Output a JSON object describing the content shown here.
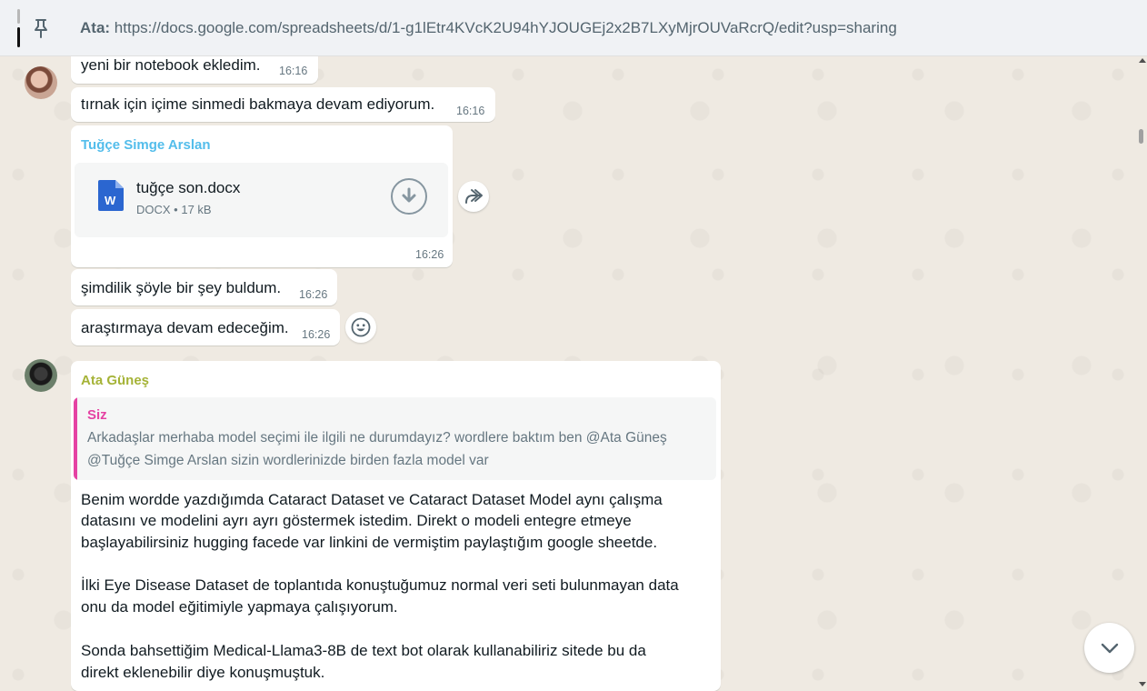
{
  "pinned": {
    "sender": "Ata:",
    "text": "https://docs.google.com/spreadsheets/d/1-g1lEtr4KVcK2U94hYJOUGEj2x2B7LXyMjrOUVaRcrQ/edit?usp=sharing"
  },
  "messages": [
    {
      "text": "yeni bir notebook ekledim.",
      "time": "16:16"
    },
    {
      "text": "tırnak için içime sinmedi bakmaya devam ediyorum.",
      "time": "16:16"
    },
    {
      "sender": "Tuğçe Simge Arslan",
      "sender_color": "#53bdeb",
      "document": {
        "name": "tuğçe son.docx",
        "meta": "DOCX • 17 kB",
        "icon": "word-doc-icon"
      },
      "time": "16:26"
    },
    {
      "text": "şimdilik şöyle bir şey buldum.",
      "time": "16:26"
    },
    {
      "text": "araştırmaya devam edeceğim.",
      "time": "16:26"
    }
  ],
  "reply_message": {
    "sender": "Ata Güneş",
    "sender_color": "#a5b337",
    "quote": {
      "sender": "Siz",
      "lines": [
        "Arkadaşlar merhaba model seçimi ile ilgili ne durumdayız? wordlere baktım ben @Ata Güneş",
        "@Tuğçe Simge Arslan sizin wordlerinizde birden fazla model var"
      ]
    },
    "body": [
      "Benim wordde yazdığımda Cataract Dataset ve Cataract Dataset Model aynı çalışma",
      "datasını ve modelini ayrı ayrı göstermek istedim. Direkt o modeli entegre etmeye",
      "başlayabilirsiniz hugging facede var linkini de vermiştim paylaştığım google sheetde.",
      "İlki Eye Disease Dataset de toplantıda konuştuğumuz normal veri seti bulunmayan data",
      "onu da model eğitimiyle yapmaya çalışıyorum.",
      "Sonda bahsettiğim Medical-Llama3-8B de text bot olarak kullanabiliriz sitede bu da",
      "direkt eklenebilir diye konuşmuştuk."
    ]
  },
  "icons": {
    "pin": "pin-icon",
    "download": "download-icon",
    "forward": "forward-icon",
    "emoji": "emoji-icon",
    "scroll_down": "chevron-down-icon"
  },
  "colors": {
    "background": "#efeae2",
    "bubble": "#ffffff",
    "quote_accent": "#e542a3",
    "word_blue": "#2b579a"
  }
}
